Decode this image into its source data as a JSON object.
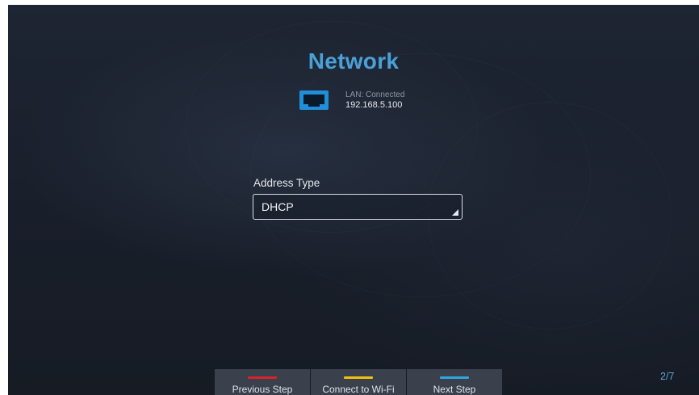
{
  "screen": {
    "title": "Network"
  },
  "lan": {
    "icon": "ethernet-port-icon",
    "status": "LAN: Connected",
    "ip": "192.168.5.100",
    "icon_color": "#1f8fd8"
  },
  "address_type": {
    "label": "Address Type",
    "value": "DHCP"
  },
  "bottom_buttons": [
    {
      "label": "Previous Step",
      "color": "#d8232a"
    },
    {
      "label": "Connect to Wi-Fi",
      "color": "#f0c20e"
    },
    {
      "label": "Next Step",
      "color": "#2ea6e0"
    }
  ],
  "page_indicator": "2/7",
  "colors": {
    "title": "#4aa0d8",
    "background": "#1c2230",
    "button_background": "#3a414d"
  }
}
